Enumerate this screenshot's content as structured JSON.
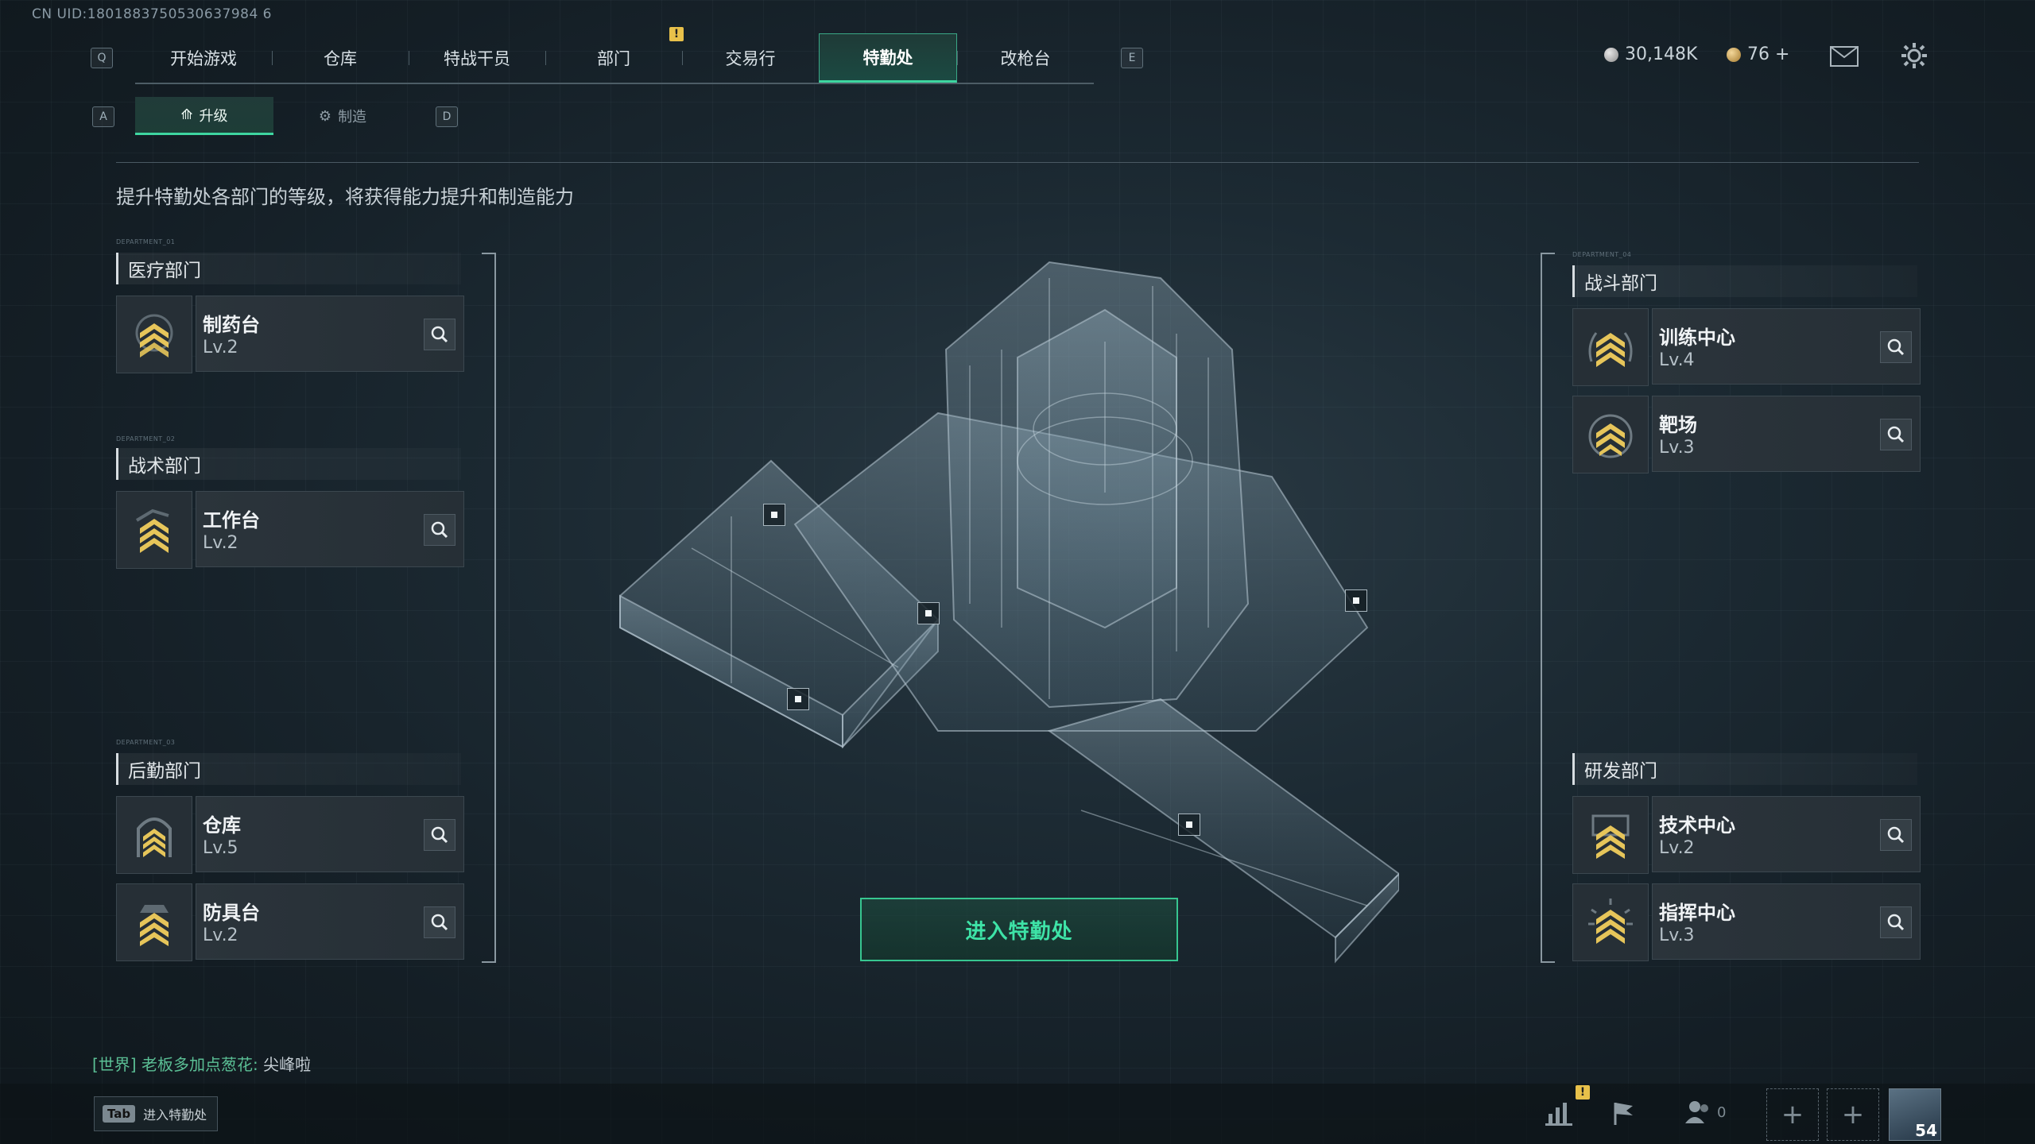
{
  "uid": "CN UID:1801883750530637984 6",
  "top_nav": {
    "key_left": "Q",
    "key_right": "E",
    "tabs": [
      "开始游戏",
      "仓库",
      "特战干员",
      "部门",
      "交易行",
      "特勤处",
      "改枪台"
    ],
    "active": "特勤处"
  },
  "currency": {
    "silver": "30,148K",
    "gold": "76 +"
  },
  "sub_tabs": {
    "key_left": "A",
    "key_right": "D",
    "tabs": [
      "升级",
      "制造"
    ],
    "active": "升级"
  },
  "description": "提升特勤处各部门的等级，将获得能力提升和制造能力",
  "departments": {
    "medical": {
      "tag": "DEPARTMENT_01",
      "title": "医疗部门",
      "facilities": [
        {
          "name": "制药台",
          "level": "Lv.2"
        }
      ]
    },
    "tactical": {
      "tag": "DEPARTMENT_02",
      "title": "战术部门",
      "facilities": [
        {
          "name": "工作台",
          "level": "Lv.2"
        }
      ]
    },
    "logistics": {
      "tag": "DEPARTMENT_03",
      "title": "后勤部门",
      "facilities": [
        {
          "name": "仓库",
          "level": "Lv.5"
        },
        {
          "name": "防具台",
          "level": "Lv.2"
        }
      ]
    },
    "combat": {
      "tag": "DEPARTMENT_04",
      "title": "战斗部门",
      "facilities": [
        {
          "name": "训练中心",
          "level": "Lv.4"
        },
        {
          "name": "靶场",
          "level": "Lv.3"
        }
      ]
    },
    "research": {
      "title": "研发部门",
      "facilities": [
        {
          "name": "技术中心",
          "level": "Lv.2"
        },
        {
          "name": "指挥中心",
          "level": "Lv.3"
        }
      ]
    }
  },
  "enter_button": "进入特勤处",
  "chat": {
    "channel": "[世界]",
    "sender": "老板多加点葱花:",
    "message": "尖峰啦"
  },
  "tab_hint": {
    "key": "Tab",
    "label": "进入特勤处"
  },
  "bottom": {
    "friends_count": "0",
    "player_level": "54"
  },
  "colors": {
    "accent": "#3ed6a0",
    "warning": "#e8c14a"
  }
}
